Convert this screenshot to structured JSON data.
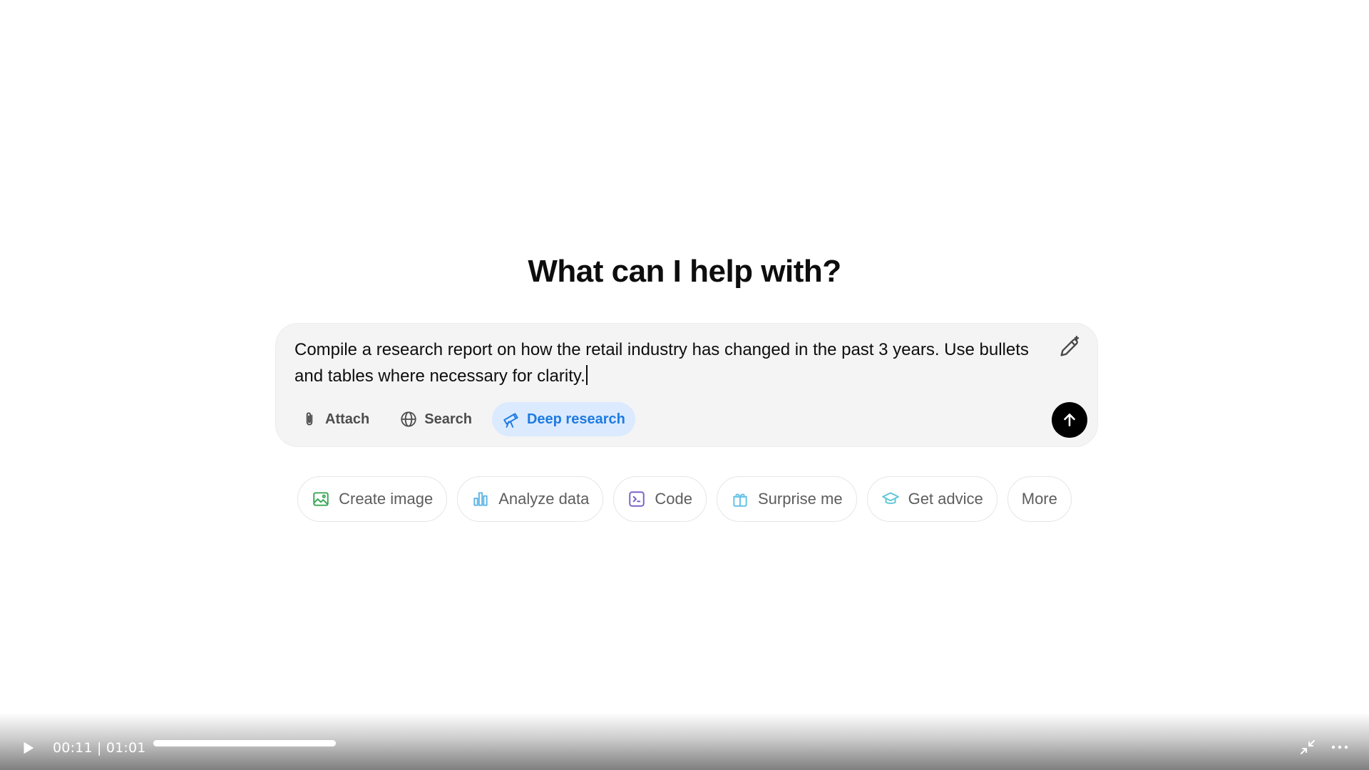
{
  "headline": "What can I help with?",
  "composer": {
    "prompt_text": "Compile a research report on how the retail industry has changed in the past 3 years. Use bullets and tables where necessary for clarity.",
    "tools": [
      {
        "label": "Attach",
        "icon": "paperclip-icon"
      },
      {
        "label": "Search",
        "icon": "globe-icon"
      },
      {
        "label": "Deep research",
        "icon": "telescope-icon",
        "active": true
      }
    ],
    "accent_color": "#1d7be0"
  },
  "suggestions": [
    {
      "label": "Create image",
      "icon": "image-icon",
      "color": "#3aa757"
    },
    {
      "label": "Analyze data",
      "icon": "bar-chart-icon",
      "color": "#5fb6e6"
    },
    {
      "label": "Code",
      "icon": "terminal-icon",
      "color": "#7b61c9"
    },
    {
      "label": "Surprise me",
      "icon": "gift-icon",
      "color": "#67c3e6"
    },
    {
      "label": "Get advice",
      "icon": "graduation-cap-icon",
      "color": "#5fc7d6"
    },
    {
      "label": "More",
      "icon": ""
    }
  ],
  "player": {
    "time": "00:11 | 01:01",
    "progress": 0.18
  }
}
